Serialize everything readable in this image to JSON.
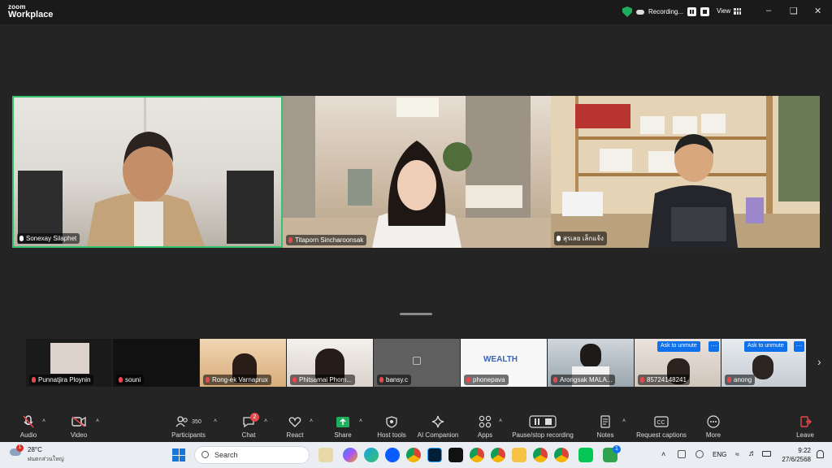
{
  "titlebar": {
    "brand_top": "zoom",
    "brand_bottom": "Workplace",
    "recording_label": "Recording...",
    "view_label": "View"
  },
  "main_participants": [
    {
      "name": "Sonexay Silaphet"
    },
    {
      "name": "Titaporn Sincharoonsak"
    },
    {
      "name": "สุรเลย เล็กแจ้ง"
    }
  ],
  "strip_participants": [
    {
      "name": "Punnatjira Ploynin"
    },
    {
      "name": "souni"
    },
    {
      "name": "Rong-ek Varnaprux"
    },
    {
      "name": "Phitsamai Phom..."
    },
    {
      "name": "bansy.c"
    },
    {
      "name": "phonepava",
      "logo": "WEALTH"
    },
    {
      "name": "Arongsak MALA..."
    },
    {
      "name": "85724148241",
      "action": "Ask to unmute"
    },
    {
      "name": "anong",
      "action": "Ask to unmute"
    }
  ],
  "toolbar": {
    "audio": "Audio",
    "video": "Video",
    "participants": "Participants",
    "participants_count": "350",
    "chat": "Chat",
    "chat_badge": "2",
    "react": "React",
    "share": "Share",
    "host_tools": "Host tools",
    "ai_companion": "AI Companion",
    "apps": "Apps",
    "pause_stop": "Pause/stop recording",
    "notes": "Notes",
    "captions": "Request captions",
    "more": "More",
    "leave": "Leave",
    "more_glyph": "···"
  },
  "taskbar": {
    "weather_temp": "28°C",
    "weather_desc": "ฝนตกส่วนใหญ่",
    "weather_badge": "1",
    "search_placeholder": "Search",
    "language": "ENG",
    "time": "9:22",
    "date": "27/6/2568",
    "app_badge": "1"
  },
  "colors": {
    "active_speaker_border": "#35c46b",
    "accent_blue": "#0e71eb",
    "muted_red": "#e5484d",
    "recording_shield": "#1fae5b"
  }
}
